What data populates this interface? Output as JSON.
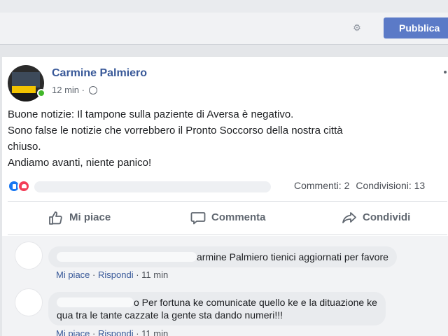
{
  "composer": {
    "gear_icon": "gear-icon",
    "publish_label": "Pubblica"
  },
  "post": {
    "author": "Carmine Palmiero",
    "time": "12 min",
    "separator": "·",
    "privacy_icon": "globe-icon",
    "text_lines": [
      "Buone notizie: Il tampone sulla paziente di Aversa è negativo.",
      "Sono false le notizie che vorrebbero il Pronto Soccorso della nostra città",
      "chiuso.",
      "Andiamo avanti, niente panico!"
    ],
    "reactions": [
      "like-icon",
      "love-icon"
    ],
    "comments_count": "Commenti: 2",
    "shares_count": "Condivisioni: 13",
    "actions": {
      "like": "Mi piace",
      "comment": "Commenta",
      "share": "Condividi"
    }
  },
  "comments": [
    {
      "text": "armine Palmiero tienici aggiornati per favore",
      "like": "Mi piace",
      "reply": "Rispondi",
      "time": "11 min"
    },
    {
      "text_line1": "o Per fortuna ke comunicate quello ke e la dituazione ke",
      "text_line2": "qua tra le tante cazzate la gente sta dando numeri!!!",
      "like": "Mi piace",
      "reply": "Rispondi",
      "time": "11 min"
    }
  ],
  "colors": {
    "brand_link": "#385898",
    "publish_button": "#5b7ac7",
    "like_blue": "#1877f2",
    "love_red": "#f33e58",
    "online_green": "#42b72a"
  }
}
